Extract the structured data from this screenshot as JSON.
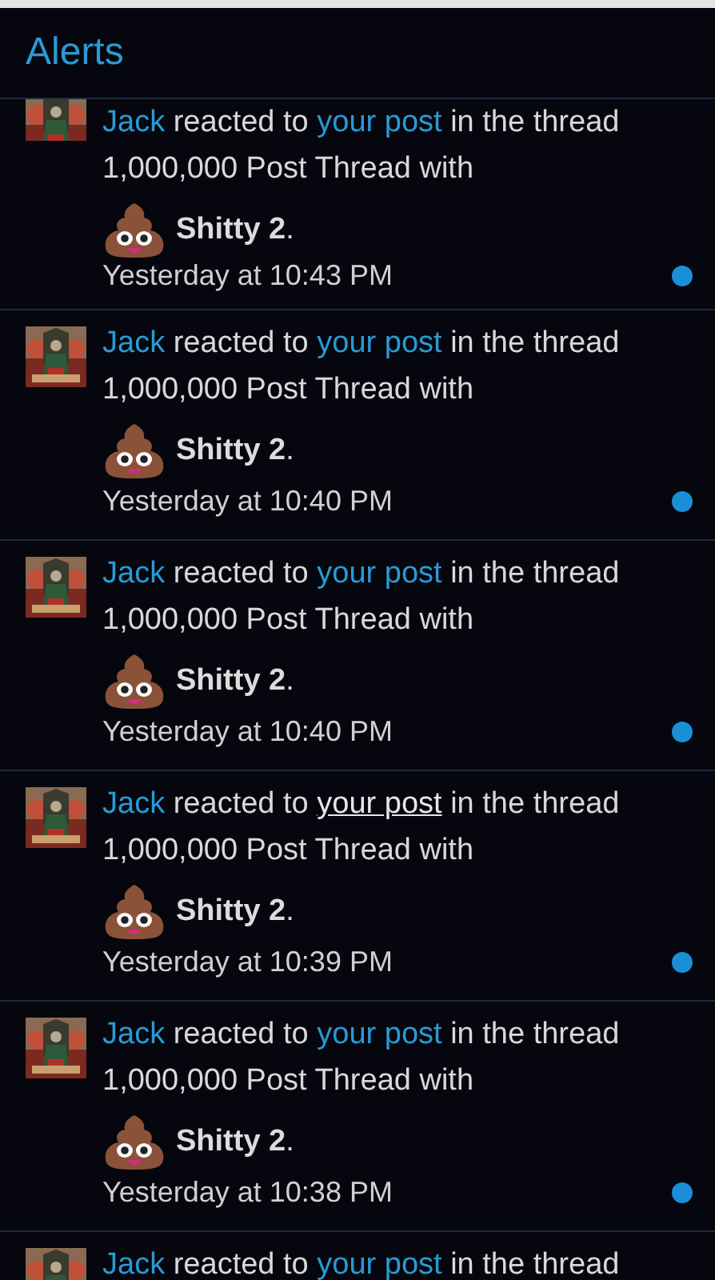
{
  "header": {
    "title": "Alerts"
  },
  "alerts": [
    {
      "actor": "Jack",
      "verb": "reacted to",
      "target": "your post",
      "context": "in the thread",
      "thread": "1,000,000 Post Thread with",
      "reaction": "**Shitty 2**.",
      "time": "Yesterday at 10:43 PM",
      "unread": true,
      "target_hovered": false
    },
    {
      "actor": "Jack",
      "verb": "reacted to",
      "target": "your post",
      "context": "in the thread",
      "thread": "1,000,000 Post Thread with",
      "reaction": "**Shitty 2**.",
      "time": "Yesterday at 10:40 PM",
      "unread": true,
      "target_hovered": false
    },
    {
      "actor": "Jack",
      "verb": "reacted to",
      "target": "your post",
      "context": "in the thread",
      "thread": "1,000,000 Post Thread with",
      "reaction": "**Shitty 2**.",
      "time": "Yesterday at 10:40 PM",
      "unread": true,
      "target_hovered": false
    },
    {
      "actor": "Jack",
      "verb": "reacted to",
      "target": "your post",
      "context": "in the thread",
      "thread": "1,000,000 Post Thread with",
      "reaction": "**Shitty 2**.",
      "time": "Yesterday at 10:39 PM",
      "unread": true,
      "target_hovered": true
    },
    {
      "actor": "Jack",
      "verb": "reacted to",
      "target": "your post",
      "context": "in the thread",
      "thread": "1,000,000 Post Thread with",
      "reaction": "**Shitty 2**.",
      "time": "Yesterday at 10:38 PM",
      "unread": true,
      "target_hovered": false
    },
    {
      "actor": "Jack",
      "verb": "reacted to",
      "target": "your post",
      "context": "in the thread",
      "target_hovered": false
    }
  ]
}
